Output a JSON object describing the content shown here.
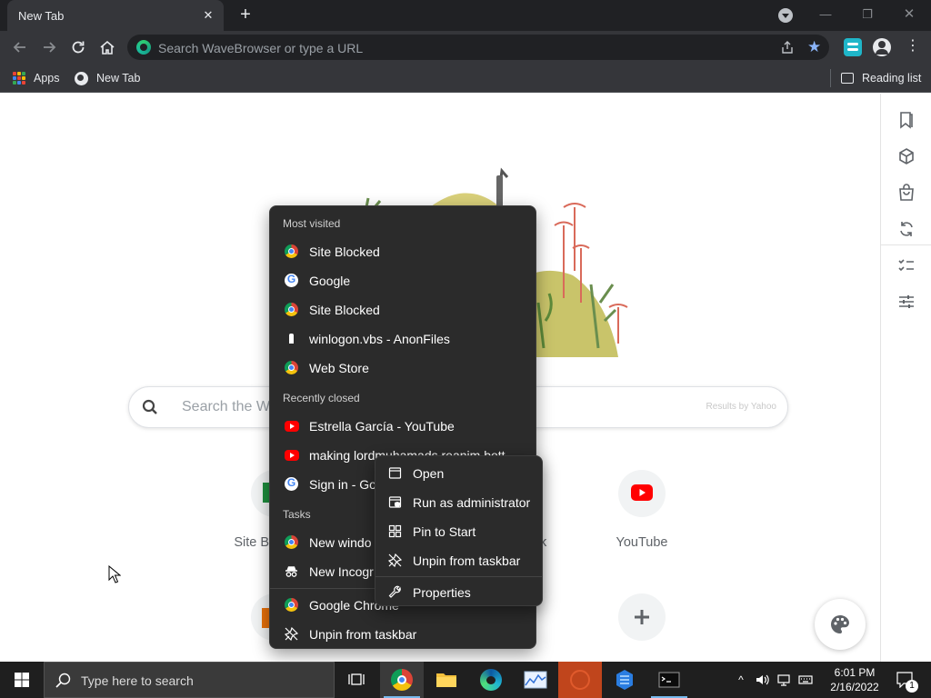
{
  "browser": {
    "tab_title": "New Tab",
    "tab_close": "✕",
    "new_tab": "+",
    "window_min": "—",
    "window_restore": "❐",
    "window_close": "✕",
    "omnibox_placeholder": "Search WaveBrowser or type a URL",
    "menu_glyph": "⋮",
    "star_glyph": "★"
  },
  "bookmarks": {
    "apps": "Apps",
    "new_tab": "New Tab",
    "reading_list": "Reading list"
  },
  "page": {
    "search_placeholder": "Search the Web",
    "results_by": "Results by Yahoo",
    "shortcuts": [
      {
        "label": "Site B"
      },
      {
        "label": "k"
      },
      {
        "label": "YouTube"
      }
    ]
  },
  "jumplist": {
    "most_visited_header": "Most visited",
    "most_visited": [
      {
        "label": "Site Blocked",
        "icon": "chrome-icon"
      },
      {
        "label": "Google",
        "icon": "google-icon"
      },
      {
        "label": "Site Blocked",
        "icon": "chrome-icon"
      },
      {
        "label": "winlogon.vbs - AnonFiles",
        "icon": "anonfiles-icon"
      },
      {
        "label": "Web Store",
        "icon": "chrome-icon"
      }
    ],
    "recently_closed_header": "Recently closed",
    "recently_closed": [
      {
        "label": "Estrella García - YouTube",
        "icon": "youtube-icon"
      },
      {
        "label": "making lordmuhamads reanim bott",
        "icon": "youtube-icon"
      },
      {
        "label": "Sign in - Go",
        "icon": "google-icon"
      }
    ],
    "tasks_header": "Tasks",
    "tasks": [
      {
        "label": "New windo",
        "icon": "chrome-icon"
      },
      {
        "label": "New Incogr",
        "icon": "incognito-icon"
      }
    ],
    "app_name": "Google Chrome",
    "unpin": "Unpin from taskbar"
  },
  "context_menu": {
    "items": [
      {
        "label": "Open",
        "icon": "window-icon"
      },
      {
        "label": "Run as administrator",
        "icon": "shield-window-icon"
      },
      {
        "label": "Pin to Start",
        "icon": "pin-start-icon"
      },
      {
        "label": "Unpin from taskbar",
        "icon": "unpin-icon"
      },
      {
        "label": "Properties",
        "icon": "wrench-icon"
      }
    ]
  },
  "taskbar": {
    "search_placeholder": "Type here to search",
    "time": "6:01 PM",
    "date": "2/16/2022",
    "notification_count": "1",
    "tray_chevron": "^"
  },
  "colors": {
    "chrome_dark": "#202124",
    "toolbar": "#35363a",
    "menu_bg": "#2b2b2b",
    "taskbar": "#1f1f1f",
    "accent_blue": "#8ab4f8"
  }
}
